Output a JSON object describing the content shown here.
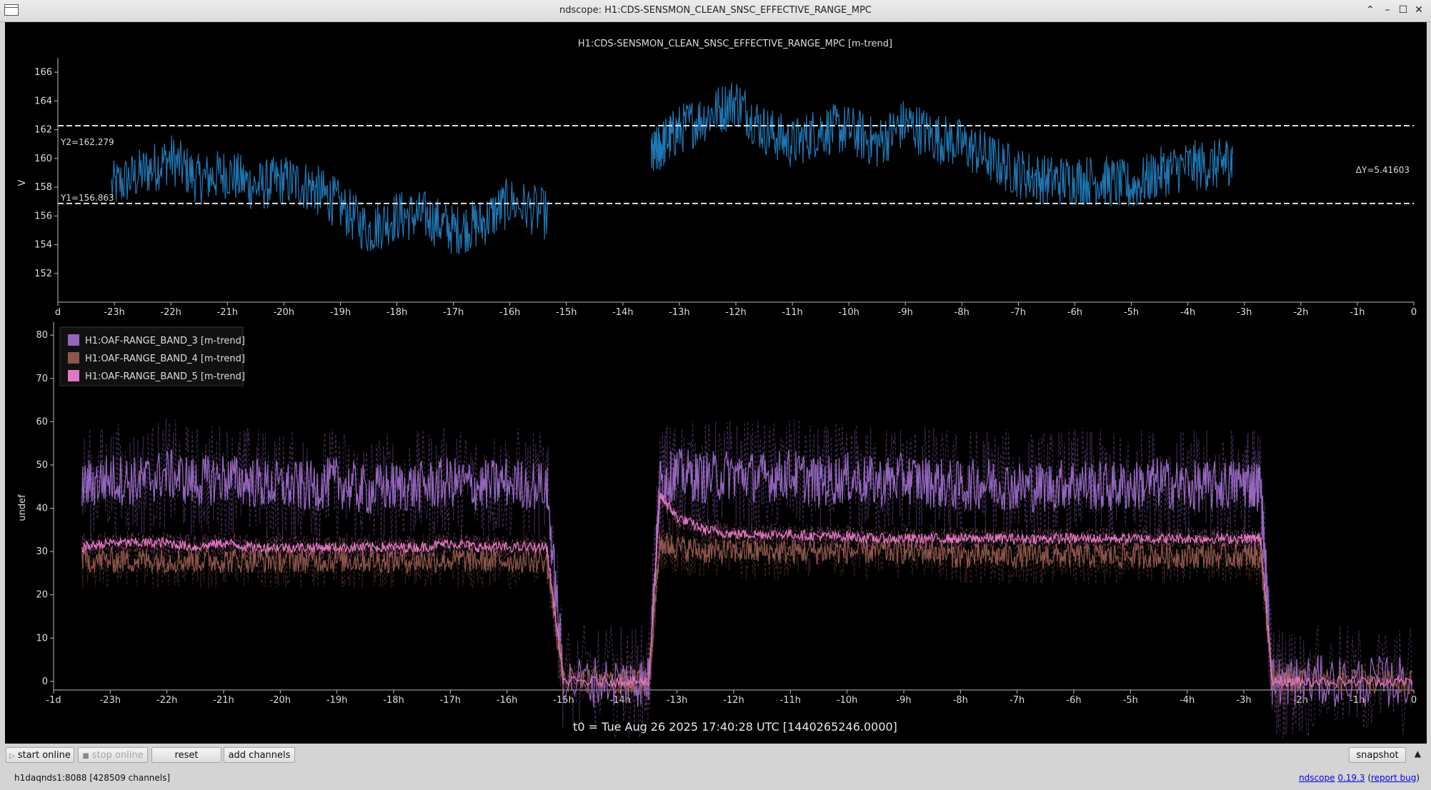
{
  "window": {
    "title": "ndscope: H1:CDS-SENSMON_CLEAN_SNSC_EFFECTIVE_RANGE_MPC"
  },
  "top_plot": {
    "title": "H1:CDS-SENSMON_CLEAN_SNSC_EFFECTIVE_RANGE_MPC [m-trend]",
    "ylabel": "V",
    "yticks": [
      "152",
      "154",
      "156",
      "158",
      "160",
      "162",
      "164",
      "166"
    ],
    "xticks": [
      "d",
      "-23h",
      "-22h",
      "-21h",
      "-20h",
      "-19h",
      "-18h",
      "-17h",
      "-16h",
      "-15h",
      "-14h",
      "-13h",
      "-12h",
      "-11h",
      "-10h",
      "-9h",
      "-8h",
      "-7h",
      "-6h",
      "-5h",
      "-4h",
      "-3h",
      "-2h",
      "-1h",
      "0"
    ],
    "cursor_y2_label": "Y2=162.279",
    "cursor_y1_label": "Y1=156.863",
    "delta_label": "ΔY=5.41603",
    "color": "#1f77b4"
  },
  "bottom_plot": {
    "ylabel": "undef",
    "yticks": [
      "0",
      "10",
      "20",
      "30",
      "40",
      "50",
      "60",
      "70",
      "80"
    ],
    "xticks": [
      "-1d",
      "-23h",
      "-22h",
      "-21h",
      "-20h",
      "-19h",
      "-18h",
      "-17h",
      "-16h",
      "-15h",
      "-14h",
      "-13h",
      "-12h",
      "-11h",
      "-10h",
      "-9h",
      "-8h",
      "-7h",
      "-6h",
      "-5h",
      "-4h",
      "-3h",
      "-2h",
      "-1h",
      "0"
    ],
    "legend": [
      {
        "label": "H1:OAF-RANGE_BAND_3 [m-trend]",
        "color": "#9467bd"
      },
      {
        "label": "H1:OAF-RANGE_BAND_4 [m-trend]",
        "color": "#8c564b"
      },
      {
        "label": "H1:OAF-RANGE_BAND_5 [m-trend]",
        "color": "#e377c2"
      }
    ]
  },
  "t0_label": "t0 = Tue Aug 26 2025 17:40:28 UTC [1440265246.0000]",
  "toolbar": {
    "start_online": "start online",
    "stop_online": "stop online",
    "reset": "reset",
    "add_channels": "add channels",
    "snapshot": "snapshot"
  },
  "status": {
    "server": "h1daqnds1:8088  [428509 channels]",
    "app_name": "ndscope",
    "version": "0.19.3",
    "report_bug": "report bug"
  },
  "chart_data": [
    {
      "type": "line",
      "title": "H1:CDS-SENSMON_CLEAN_SNSC_EFFECTIVE_RANGE_MPC [m-trend]",
      "xlabel": "",
      "ylabel": "V",
      "xlim": [
        -24,
        0
      ],
      "ylim": [
        150,
        167
      ],
      "x": [
        -23.05,
        -22.5,
        -22,
        -21.5,
        -21,
        -20.5,
        -20,
        -19.5,
        -19.1,
        -18.5,
        -18,
        -17.5,
        -17,
        -16.5,
        -16,
        -15.3,
        -15.2,
        -13.5,
        -13.3,
        -13,
        -12.5,
        -12,
        -11.5,
        -11,
        -10.5,
        -10,
        -9.5,
        -9,
        -8.5,
        -8,
        -7.5,
        -7,
        -6.5,
        -6,
        -5.5,
        -5,
        -4.5,
        -4,
        -3.5,
        -3.2
      ],
      "series": [
        {
          "values": [
            158,
            159,
            160,
            158.5,
            159,
            158,
            158.5,
            158,
            157,
            155,
            156,
            156,
            155,
            155.5,
            157,
            156,
            null,
            160,
            161,
            162,
            163,
            164,
            162,
            161,
            162,
            162,
            161,
            162.5,
            161.5,
            161,
            160,
            159,
            158.5,
            158.5,
            158.5,
            158,
            159,
            159.5,
            159.5,
            160
          ]
        }
      ],
      "cursors": {
        "Y1": 156.863,
        "Y2": 162.279,
        "dY": 5.41603
      },
      "grid": false
    },
    {
      "type": "line",
      "title": "",
      "xlabel": "",
      "ylabel": "undef",
      "xlim": [
        -24,
        0
      ],
      "ylim": [
        -2,
        83
      ],
      "legend_position": "top-left",
      "x": [
        -23.5,
        -23,
        -22.5,
        -22,
        -21.5,
        -21,
        -20.5,
        -20,
        -19.5,
        -19,
        -18.5,
        -18,
        -17.5,
        -17,
        -16.5,
        -16,
        -15.3,
        -15,
        -14,
        -13.5,
        -13.3,
        -13,
        -12.5,
        -12,
        -11.5,
        -11,
        -10.5,
        -10,
        -9.5,
        -9,
        -8.5,
        -8,
        -7.5,
        -7,
        -6.5,
        -6,
        -5.5,
        -5,
        -4.5,
        -4,
        -3.5,
        -3,
        -2.7,
        -2.5,
        -2,
        -1,
        0
      ],
      "series": [
        {
          "name": "H1:OAF-RANGE_BAND_3 [m-trend]",
          "values": [
            45,
            47,
            46,
            48,
            46,
            47,
            46,
            45,
            45,
            46,
            44,
            45,
            45,
            46,
            45,
            46,
            45,
            0,
            0,
            0,
            46,
            48,
            47,
            48,
            47,
            48,
            46,
            47,
            46,
            47,
            46,
            45,
            46,
            45,
            45,
            46,
            45,
            45,
            46,
            45,
            45,
            46,
            45,
            0,
            0,
            0,
            0
          ]
        },
        {
          "name": "H1:OAF-RANGE_BAND_4 [m-trend]",
          "values": [
            28,
            28,
            28,
            28,
            28,
            28,
            28,
            28,
            28,
            28,
            28,
            28,
            28,
            28,
            28,
            28,
            28,
            0,
            0,
            0,
            32,
            31,
            30,
            30,
            30,
            30,
            30,
            30,
            30,
            30,
            30,
            29,
            29,
            29,
            29,
            29,
            29,
            29,
            29,
            29,
            29,
            29,
            29,
            0,
            0,
            0,
            0
          ]
        },
        {
          "name": "H1:OAF-RANGE_BAND_5 [m-trend]",
          "values": [
            31,
            32,
            32,
            32,
            31,
            32,
            31,
            31,
            31,
            31,
            31,
            31,
            31,
            32,
            31,
            31,
            31,
            0,
            0,
            0,
            43,
            38,
            35,
            34,
            34,
            34,
            33.5,
            33.5,
            33,
            33,
            33,
            33,
            33,
            33,
            33,
            33,
            33,
            33,
            33,
            33,
            33,
            33,
            33,
            0,
            0,
            0,
            0
          ]
        }
      ],
      "grid": false
    }
  ]
}
